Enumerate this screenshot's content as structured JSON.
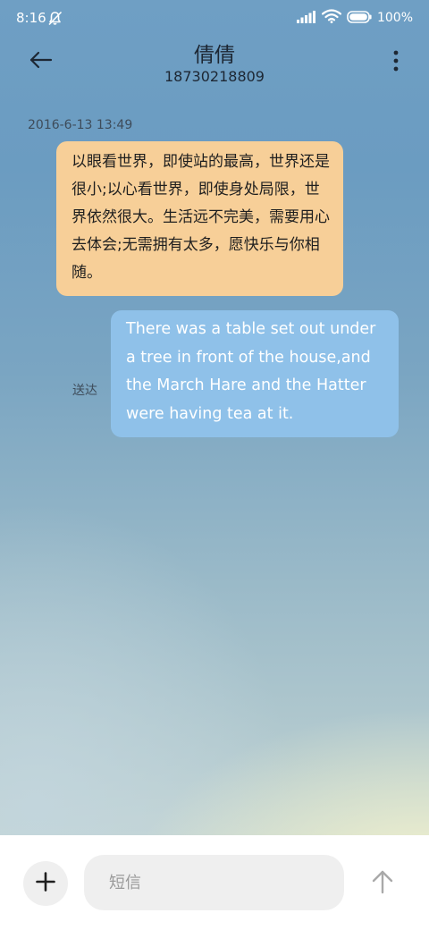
{
  "status_bar": {
    "time": "8:16",
    "battery_text": "100%",
    "icons": [
      "bell-muted-icon",
      "signal-icon",
      "wifi-icon",
      "battery-icon"
    ]
  },
  "header": {
    "contact_name": "倩倩",
    "contact_number": "18730218809",
    "icons": [
      "back-arrow-icon",
      "more-vertical-icon"
    ]
  },
  "conversation": {
    "timestamp": "2016-6-13 13:49",
    "messages": [
      {
        "direction": "incoming",
        "text": "以眼看世界，即使站的最高，世界还是很小;以心看世界，即使身处局限，世界依然很大。生活远不完美，需要用心去体会;无需拥有太多，愿快乐与你相随。"
      },
      {
        "direction": "outgoing",
        "text": "There was a table set out under a tree in front of the house,and the March Hare and the Hatter were having tea at it.",
        "status": "送达"
      }
    ]
  },
  "input_bar": {
    "placeholder": "短信",
    "value": "",
    "icons": [
      "plus-icon",
      "send-arrow-icon"
    ]
  },
  "colors": {
    "incoming_bubble": "#f7cf98",
    "outgoing_bubble": "#8fc1e9",
    "input_background": "#efefef"
  }
}
